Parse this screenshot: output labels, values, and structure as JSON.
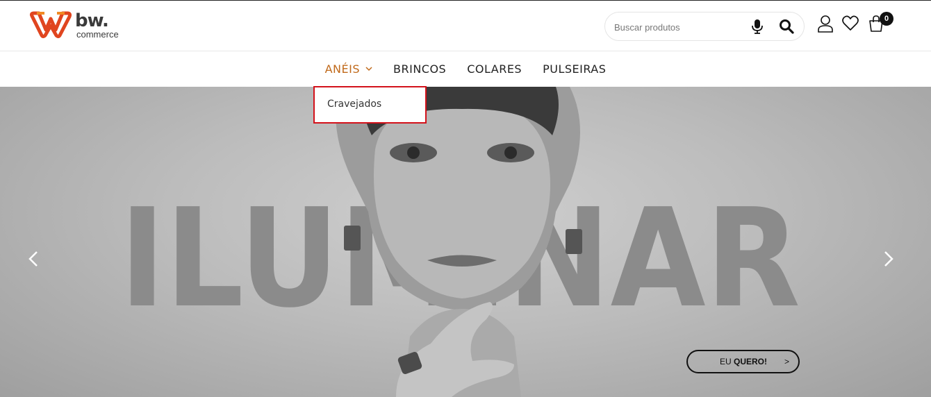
{
  "header": {
    "logo_brand": "bw.",
    "logo_tagline": "commerce",
    "search_placeholder": "Buscar produtos",
    "cart_count": "0",
    "icons": [
      "mic-icon",
      "search-icon",
      "user-icon",
      "heart-icon",
      "bag-icon"
    ]
  },
  "nav": {
    "items": [
      {
        "label": "ANÉIS",
        "active": true
      },
      {
        "label": "BRINCOS"
      },
      {
        "label": "COLARES"
      },
      {
        "label": "PULSEIRAS"
      }
    ]
  },
  "dropdown": {
    "items": [
      {
        "label": "Cravejados"
      }
    ]
  },
  "hero": {
    "banner_word": "ILUMINAR",
    "cta_prefix": "EU",
    "cta_strong": "QUERO!",
    "cta_arrow": ">",
    "prev_icon": "chevron-left-icon",
    "next_icon": "chevron-right-icon"
  },
  "colors": {
    "accent": "#c0691a",
    "logo": "#e0451f",
    "dropdown_border": "#d3111a"
  }
}
